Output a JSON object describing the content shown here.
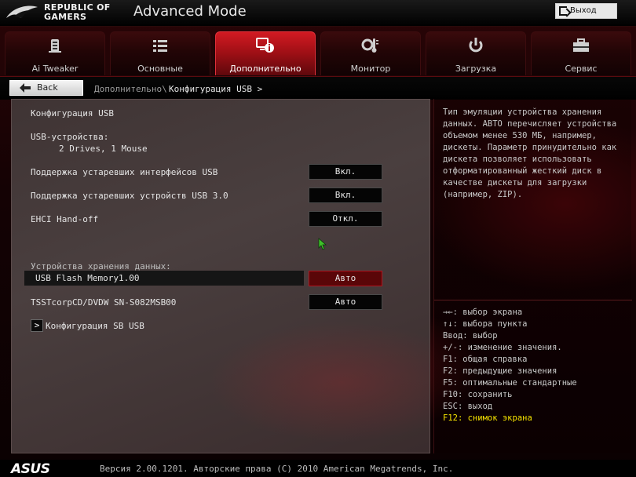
{
  "header": {
    "brand_line1": "REPUBLIC OF",
    "brand_line2": "GAMERS",
    "mode_title": "Advanced Mode",
    "exit_label": "Выход"
  },
  "tabs": [
    {
      "label": "Ai Tweaker",
      "icon": "tweaker-icon",
      "active": false
    },
    {
      "label": "Основные",
      "icon": "list-icon",
      "active": false
    },
    {
      "label": "Дополнительно",
      "icon": "advanced-info-icon",
      "active": true
    },
    {
      "label": "Монитор",
      "icon": "thermometer-icon",
      "active": false
    },
    {
      "label": "Загрузка",
      "icon": "power-icon",
      "active": false
    },
    {
      "label": "Сервис",
      "icon": "toolbox-icon",
      "active": false
    }
  ],
  "nav": {
    "back_label": "Back",
    "breadcrumb_prefix": "Дополнительно\\",
    "breadcrumb_current": "Конфигурация USB >"
  },
  "main": {
    "section_title": "Конфигурация USB",
    "devices_label": "USB-устройства:",
    "devices_value": "2 Drives, 1 Mouse",
    "settings": [
      {
        "label": "Поддержка устаревших интерфейсов USB",
        "value": "Вкл."
      },
      {
        "label": "Поддержка устаревших устройств USB 3.0",
        "value": "Вкл."
      },
      {
        "label": "EHCI Hand-off",
        "value": "Откл."
      }
    ],
    "storage_header": "Устройства хранения данных:",
    "storage_devices": [
      {
        "label": "USB Flash Memory1.00",
        "value": "Авто",
        "selected": true
      },
      {
        "label": "TSSTcorpCD/DVDW SN-S082MSB00",
        "value": "Авто",
        "selected": false
      }
    ],
    "submenu_arrow": ">",
    "submenu_label": "Конфигурация SB USB"
  },
  "help": {
    "description": "Тип эмуляции устройства хранения данных. АВТО перечисляет устройства объемом менее 530 МБ, например, дискеты. Параметр принудительно как дискета позволяет использовать отформатированный жесткий диск в качестве дискеты для загрузки (например, ZIP).",
    "keys": [
      "→←: выбор экрана",
      "↑↓: выбора пункта",
      "Ввод: выбор",
      "+/-: изменение значения.",
      "F1: общая справка",
      "F2: предыдущие значения",
      "F5: оптимальные стандартные",
      "F10: сохранить",
      "ESC: выход",
      "F12: снимок экрана"
    ]
  },
  "footer": {
    "logo_text": "ASUS",
    "copyright": "Версия 2.00.1201. Авторские права (C) 2010 American Megatrends, Inc."
  },
  "colors": {
    "accent_red": "#c8161e",
    "highlight_yellow": "#f7e300"
  }
}
